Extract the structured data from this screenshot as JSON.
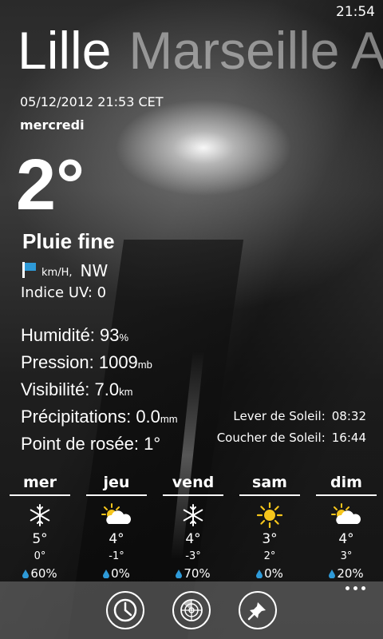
{
  "status": {
    "time": "21:54"
  },
  "pivot": {
    "active": "Lille",
    "next": "Marseille A"
  },
  "current": {
    "datetime": "05/12/2012 21:53 CET",
    "weekday": "mercredi",
    "temperature": "2°",
    "condition": "Pluie fine",
    "wind_unit": "km/H,",
    "wind_direction": "NW",
    "uv_label": "Indice UV:",
    "uv_value": "0"
  },
  "details": {
    "humidity_label": "Humidité:",
    "humidity_value": "93",
    "humidity_unit": "%",
    "pressure_label": "Pression:",
    "pressure_value": "1009",
    "pressure_unit": "mb",
    "visibility_label": "Visibilité:",
    "visibility_value": "7.0",
    "visibility_unit": "km",
    "precip_label": "Précipitations:",
    "precip_value": "0.0",
    "precip_unit": "mm",
    "dew_label": "Point de rosée:",
    "dew_value": "1°"
  },
  "sun": {
    "sunrise_label": "Lever de Soleil:",
    "sunrise_value": "08:32",
    "sunset_label": "Coucher de Soleil:",
    "sunset_value": "16:44"
  },
  "forecast": [
    {
      "day": "mer",
      "icon": "snowflake-icon",
      "high": "5°",
      "low": "0°",
      "precip": "60%"
    },
    {
      "day": "jeu",
      "icon": "sun-cloud-icon",
      "high": "4°",
      "low": "-1°",
      "precip": "0%"
    },
    {
      "day": "vend",
      "icon": "snowflake-icon",
      "high": "4°",
      "low": "-3°",
      "precip": "70%"
    },
    {
      "day": "sam",
      "icon": "sun-icon",
      "high": "3°",
      "low": "2°",
      "precip": "0%"
    },
    {
      "day": "dim",
      "icon": "sun-cloud-icon",
      "high": "4°",
      "low": "3°",
      "precip": "20%"
    }
  ],
  "appbar": {
    "buttons": [
      "clock-icon",
      "radar-icon",
      "pin-icon"
    ]
  },
  "colors": {
    "accent": "#2e9ad8",
    "sun": "#f5c51c"
  }
}
